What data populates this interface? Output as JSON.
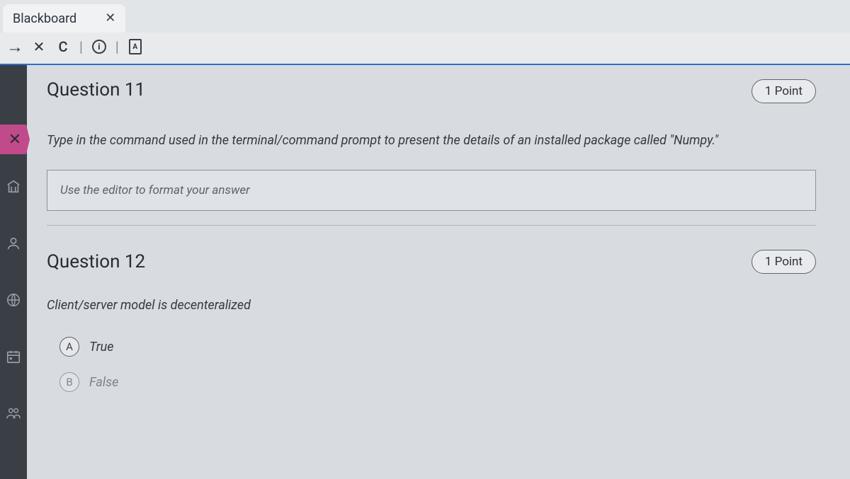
{
  "browser": {
    "tab_title": "Blackboard",
    "toolbar": {
      "forward_glyph": "→",
      "stop_glyph": "✕",
      "reload_glyph": "C",
      "info_glyph": "i",
      "doc_glyph": "A"
    }
  },
  "rail": {
    "x_badge": "✕"
  },
  "questions": [
    {
      "number": "Question 11",
      "points": "1 Point",
      "prompt": "Type in the command used in the terminal/command prompt to present the details of an installed package called \"Numpy.\"",
      "editor_placeholder": "Use the editor to format your answer"
    },
    {
      "number": "Question 12",
      "points": "1 Point",
      "prompt": "Client/server model is decenteralized",
      "options": [
        {
          "letter": "A",
          "label": "True"
        },
        {
          "letter": "B",
          "label": "False"
        }
      ]
    }
  ]
}
